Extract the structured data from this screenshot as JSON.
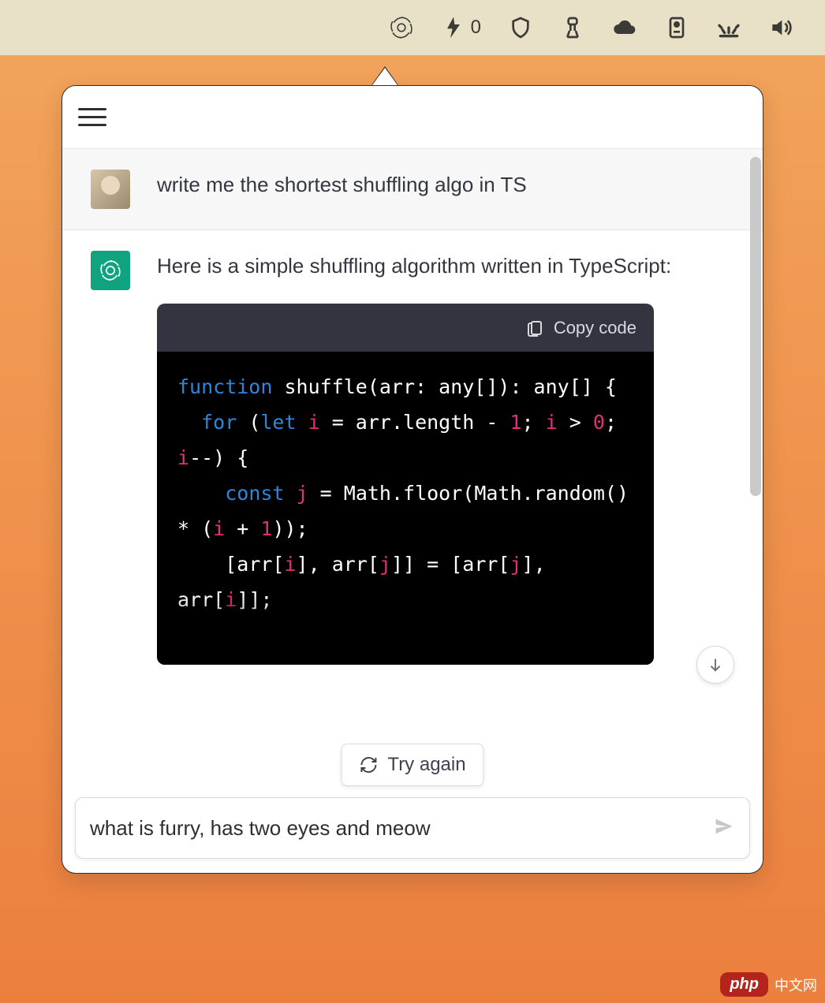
{
  "menubar": {
    "bolt_count": "0"
  },
  "chat": {
    "user_message": "write me the shortest shuffling algo in TS",
    "assistant_intro": "Here is a simple shuffling algorithm written in TypeScript:",
    "code": {
      "copy_label": "Copy code",
      "tokens": [
        {
          "t": "function",
          "c": "kw"
        },
        {
          "t": " shuffle(arr: any[]): any[] {\n  "
        },
        {
          "t": "for",
          "c": "kw"
        },
        {
          "t": " ("
        },
        {
          "t": "let",
          "c": "kw"
        },
        {
          "t": " "
        },
        {
          "t": "i",
          "c": "var"
        },
        {
          "t": " = arr.length - "
        },
        {
          "t": "1",
          "c": "num"
        },
        {
          "t": "; "
        },
        {
          "t": "i",
          "c": "var"
        },
        {
          "t": " > "
        },
        {
          "t": "0",
          "c": "num"
        },
        {
          "t": "; "
        },
        {
          "t": "i",
          "c": "var"
        },
        {
          "t": "--) {\n    "
        },
        {
          "t": "const",
          "c": "kw"
        },
        {
          "t": " "
        },
        {
          "t": "j",
          "c": "var"
        },
        {
          "t": " = Math.floor(Math.random() * ("
        },
        {
          "t": "i",
          "c": "var"
        },
        {
          "t": " + "
        },
        {
          "t": "1",
          "c": "num"
        },
        {
          "t": "));\n    [arr["
        },
        {
          "t": "i",
          "c": "var"
        },
        {
          "t": "], arr["
        },
        {
          "t": "j",
          "c": "var"
        },
        {
          "t": "]] = [arr["
        },
        {
          "t": "j",
          "c": "var"
        },
        {
          "t": "], arr["
        },
        {
          "t": "i",
          "c": "var"
        },
        {
          "t": "]];"
        }
      ]
    }
  },
  "controls": {
    "try_again": "Try again"
  },
  "input": {
    "value": "what is furry, has two eyes and meow",
    "placeholder": ""
  },
  "watermark": {
    "badge": "php",
    "text": "中文网"
  }
}
